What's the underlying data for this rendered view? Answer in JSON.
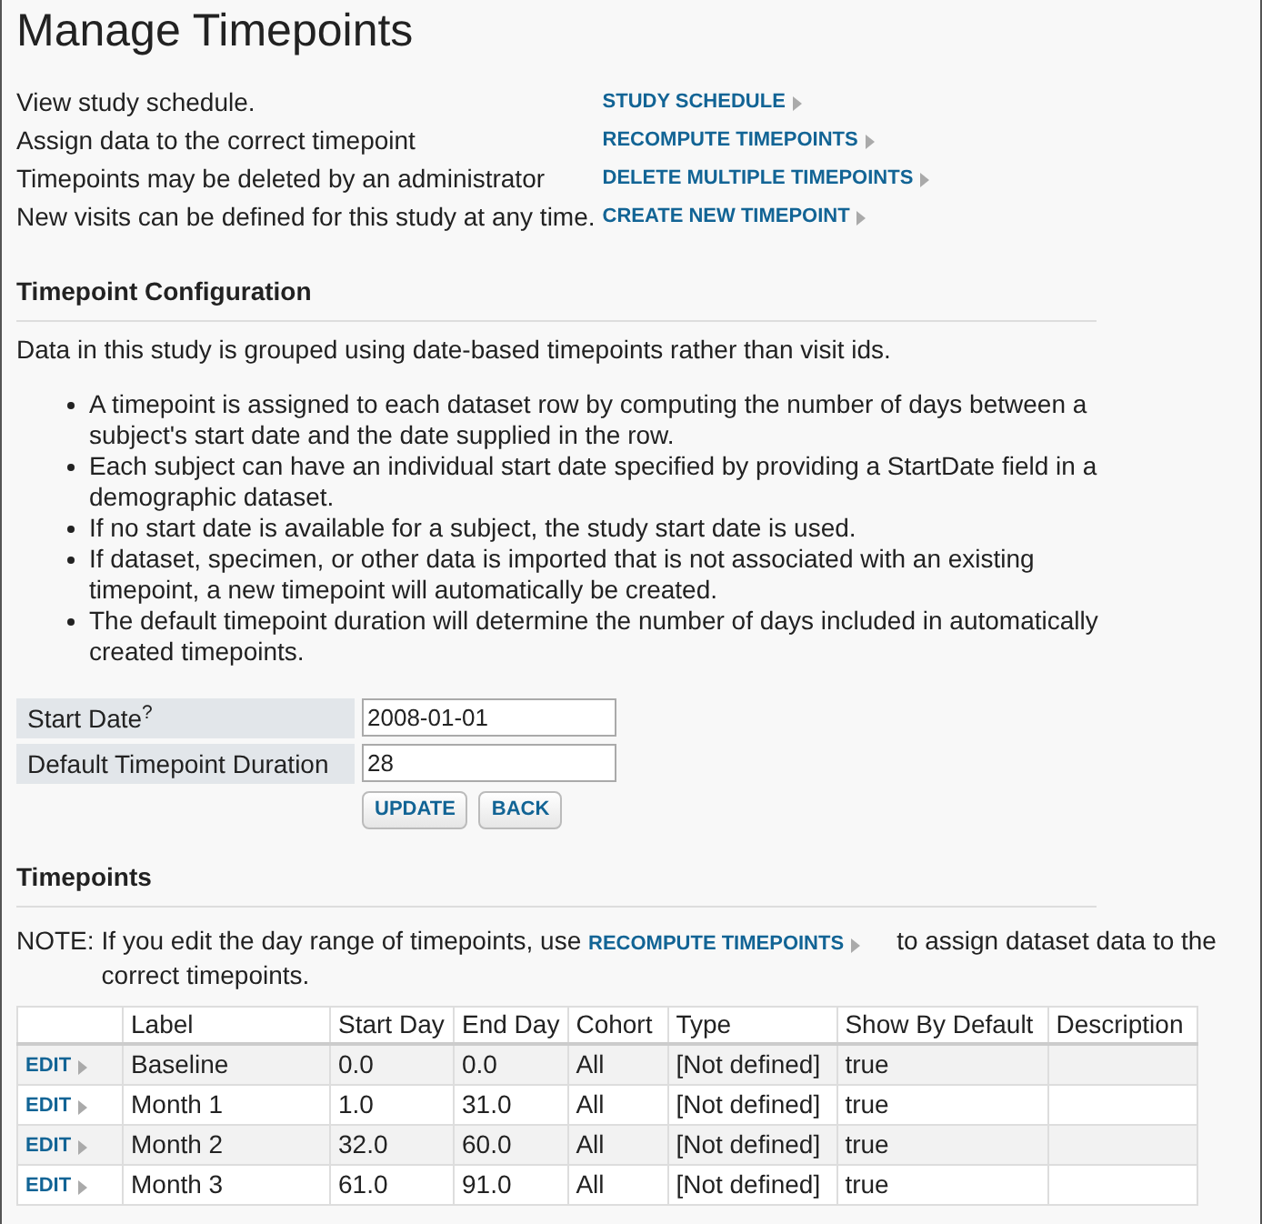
{
  "title": "Manage Timepoints",
  "actions": [
    {
      "description": "View study schedule.",
      "link": "STUDY SCHEDULE"
    },
    {
      "description": "Assign data to the correct timepoint",
      "link": "RECOMPUTE TIMEPOINTS"
    },
    {
      "description": "Timepoints may be deleted by an administrator",
      "link": "DELETE MULTIPLE TIMEPOINTS"
    },
    {
      "description": "New visits can be defined for this study at any time.",
      "link": "CREATE NEW TIMEPOINT"
    }
  ],
  "configuration": {
    "heading": "Timepoint Configuration",
    "intro": "Data in this study is grouped using date-based timepoints rather than visit ids.",
    "bullets": [
      "A timepoint is assigned to each dataset row by computing the number of days between a subject's start date and the date supplied in the row.",
      "Each subject can have an individual start date specified by providing a StartDate field in a demographic dataset.",
      "If no start date is available for a subject, the study start date is used.",
      "If dataset, specimen, or other data is imported that is not associated with an existing timepoint, a new timepoint will automatically be created.",
      "The default timepoint duration will determine the number of days included in automatically created timepoints."
    ],
    "fields": [
      {
        "label": "Start Date$^{?}$",
        "value": "2008-01-01"
      },
      {
        "label": "Default Timepoint Duration",
        "value": "28"
      }
    ],
    "buttons": [
      "UPDATE",
      "BACK"
    ]
  },
  "timepoints": {
    "heading": "Timepoints",
    "note_prefix": "NOTE:",
    "note_before": "If you edit the day range of timepoints, use",
    "note_link": "RECOMPUTE TIMEPOINTS",
    "note_after": "to assign dataset data to the correct timepoints.",
    "columns": [
      "Label",
      "Start Day",
      "End Day",
      "Cohort",
      "Type",
      "Show By Default",
      "Description"
    ],
    "rows": [
      {
        "action": "EDIT",
        "cells": [
          "Baseline",
          "0.0",
          "0.0",
          "All",
          "[Not defined]",
          "true"
        ]
      },
      {
        "action": "EDIT",
        "cells": [
          "Month 1",
          "1.0",
          "31.0",
          "All",
          "[Not defined]",
          "true"
        ]
      },
      {
        "action": "EDIT",
        "cells": [
          "Month 2",
          "32.0",
          "60.0",
          "All",
          "[Not defined]",
          "true"
        ]
      },
      {
        "action": "EDIT",
        "cells": [
          "Month 3",
          "61.0",
          "91.0",
          "All",
          "[Not defined]",
          "true"
        ]
      }
    ]
  }
}
